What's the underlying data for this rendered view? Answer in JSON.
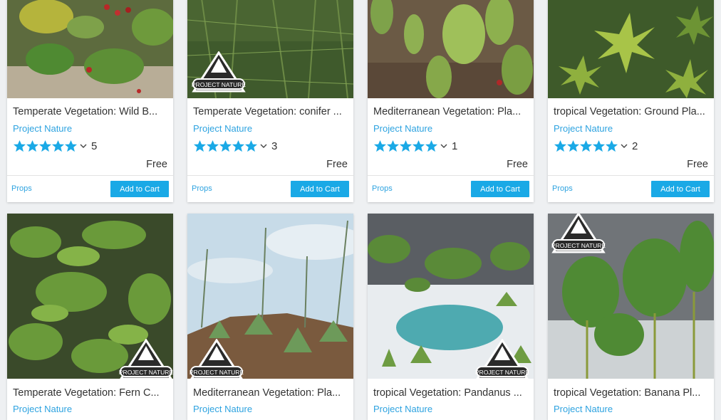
{
  "products": [
    {
      "title": "Temperate Vegetation: Wild B...",
      "publisher": "Project Nature",
      "rating": "5",
      "price": "Free",
      "category": "Props",
      "cart": "Add to Cart",
      "scene": "wild-berry"
    },
    {
      "title": "Temperate Vegetation: conifer ...",
      "publisher": "Project Nature",
      "rating": "3",
      "price": "Free",
      "category": "Props",
      "cart": "Add to Cart",
      "scene": "conifer"
    },
    {
      "title": "Mediterranean Vegetation: Pla...",
      "publisher": "Project Nature",
      "rating": "1",
      "price": "Free",
      "category": "Props",
      "cart": "Add to Cart",
      "scene": "cactus"
    },
    {
      "title": "tropical Vegetation: Ground Pla...",
      "publisher": "Project Nature",
      "rating": "2",
      "price": "Free",
      "category": "Props",
      "cart": "Add to Cart",
      "scene": "ground-plants"
    },
    {
      "title": "Temperate Vegetation: Fern C...",
      "publisher": "Project Nature",
      "scene": "fern"
    },
    {
      "title": "Mediterranean Vegetation: Pla...",
      "publisher": "Project Nature",
      "scene": "agave"
    },
    {
      "title": "tropical Vegetation: Pandanus ...",
      "publisher": "Project Nature",
      "scene": "pandanus"
    },
    {
      "title": "tropical Vegetation: Banana Pl...",
      "publisher": "Project Nature",
      "scene": "banana"
    }
  ],
  "logo_text": "PROJECT NATURE",
  "colors": {
    "accent": "#1aa9e6",
    "link": "#2ea3e0",
    "star": "#1aa9e6"
  },
  "icons": {
    "star": "star-icon",
    "chevron": "chevron-down-icon"
  }
}
